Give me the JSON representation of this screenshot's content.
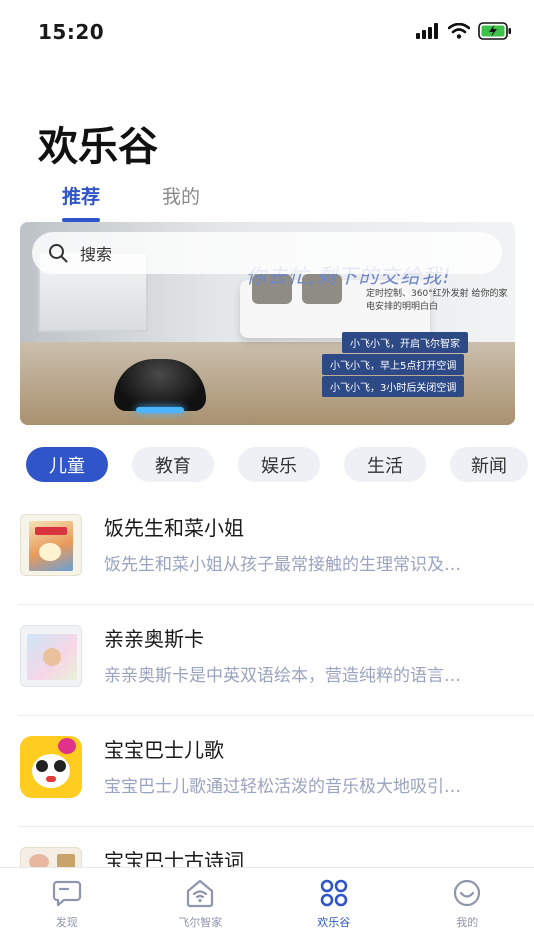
{
  "status": {
    "time": "15:20"
  },
  "header": {
    "title": "欢乐谷"
  },
  "tabs": [
    {
      "label": "推荐",
      "active": true
    },
    {
      "label": "我的",
      "active": false
    }
  ],
  "search": {
    "placeholder": "搜索"
  },
  "banner": {
    "slogan": "你去忙,剩下的交给我!",
    "desc": "定时控制、360°红外发射 给你的家电安排的明明白白",
    "commands": [
      "小飞小飞，开启飞尔智家",
      "小飞小飞，早上5点打开空调",
      "小飞小飞，3小时后关闭空调"
    ]
  },
  "categories": [
    {
      "label": "儿童",
      "active": true
    },
    {
      "label": "教育",
      "active": false
    },
    {
      "label": "娱乐",
      "active": false
    },
    {
      "label": "生活",
      "active": false
    },
    {
      "label": "新闻",
      "active": false
    }
  ],
  "items": [
    {
      "title": "饭先生和菜小姐",
      "desc": "饭先生和菜小姐从孩子最常接触的生理常识及…"
    },
    {
      "title": "亲亲奥斯卡",
      "desc": "亲亲奥斯卡是中英双语绘本，营造纯粹的语言…"
    },
    {
      "title": "宝宝巴士儿歌",
      "desc": "宝宝巴士儿歌通过轻松活泼的音乐极大地吸引…"
    },
    {
      "title": "宝宝巴士古诗词",
      "desc": ""
    }
  ],
  "bottom_nav": [
    {
      "label": "发现",
      "icon": "chat-bubble-icon",
      "active": false
    },
    {
      "label": "飞尔智家",
      "icon": "smart-home-icon",
      "active": false
    },
    {
      "label": "欢乐谷",
      "icon": "grid-icon",
      "active": true
    },
    {
      "label": "我的",
      "icon": "smile-icon",
      "active": false
    }
  ],
  "colors": {
    "accent": "#2f55c8",
    "muted_text": "#9aa3bf",
    "chip_bg": "#eef0f5"
  }
}
